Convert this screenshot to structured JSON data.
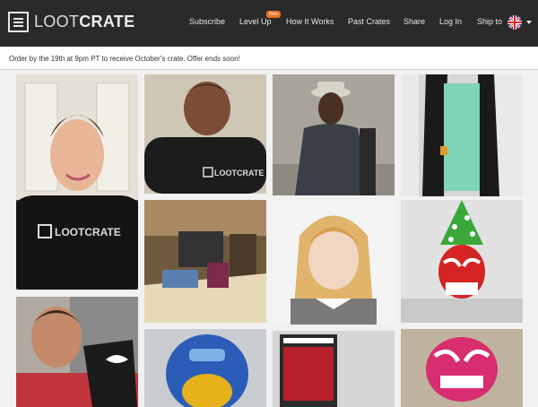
{
  "brand": {
    "logo_light": "LOOT",
    "logo_bold": "CRATE"
  },
  "nav": {
    "items": [
      {
        "label": "Subscribe"
      },
      {
        "label": "Level Up"
      },
      {
        "label": "How It Works"
      },
      {
        "label": "Past Crates"
      },
      {
        "label": "Share"
      },
      {
        "label": "Log In"
      },
      {
        "label": "Ship to"
      }
    ],
    "badge": "New"
  },
  "promo": {
    "text": "Order by the 19th at 9pm PT to receive October's crate. Offer ends soon!"
  },
  "tshirt_brand": "LOOTCRATE",
  "colors": {
    "navbar": "#2a2a2a",
    "badge": "#f07020",
    "page_bg": "#f1f1f1"
  },
  "icons": {
    "flag": "uk-flag-icon",
    "dropdown": "chevron-down-icon"
  }
}
